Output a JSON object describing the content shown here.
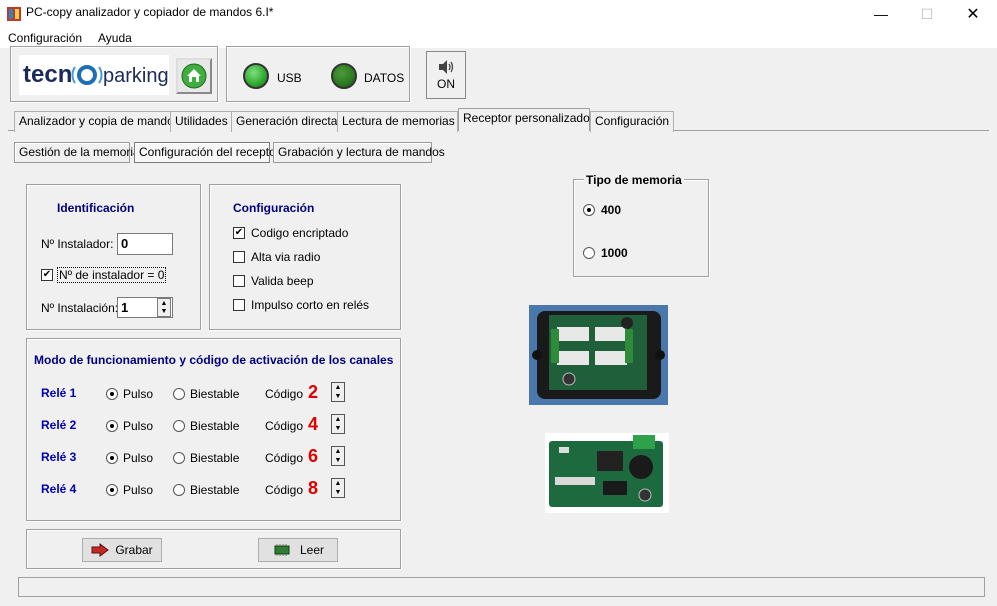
{
  "window": {
    "title": "PC-copy analizador y copiador de mandos 6.I*",
    "minimize": "—",
    "maximize": "☐",
    "close": "✕"
  },
  "menu": {
    "items": [
      {
        "label": "Configuración"
      },
      {
        "label": "Ayuda"
      }
    ]
  },
  "header": {
    "logo_left": "tecn",
    "logo_right": "parking",
    "led_usb": {
      "label": "USB",
      "color": "#2ea82e"
    },
    "led_datos": {
      "label": "DATOS",
      "color": "#2a7a1e"
    },
    "sound_label": "ON"
  },
  "tabs": [
    {
      "label": "Analizador y copia de mandos"
    },
    {
      "label": "Utilidades"
    },
    {
      "label": "Generación directa"
    },
    {
      "label": "Lectura de memorias"
    },
    {
      "label": "Receptor personalizado",
      "active": true
    },
    {
      "label": "Configuración"
    }
  ],
  "subtabs": [
    {
      "label": "Gestión de la memoria"
    },
    {
      "label": "Configuración del receptor",
      "active": true
    },
    {
      "label": "Grabación y lectura de mandos"
    }
  ],
  "identificacion": {
    "title": "Identificación",
    "instalador_label": "Nº Instalador:",
    "instalador_value": "0",
    "instalador_zero_label": "Nº de instalador = 0",
    "instalador_zero_checked": true,
    "instalacion_label": "Nº Instalación:",
    "instalacion_value": "1"
  },
  "configuracion": {
    "title": "Configuración",
    "options": [
      {
        "label": "Codigo encriptado",
        "checked": true
      },
      {
        "label": "Alta via radio",
        "checked": false
      },
      {
        "label": "Valida beep",
        "checked": false
      },
      {
        "label": "Impulso corto en relés",
        "checked": false
      }
    ]
  },
  "modo": {
    "title": "Modo de funcionamiento y código de activación de los canales",
    "pulso_label": "Pulso",
    "biestable_label": "Biestable",
    "codigo_label": "Código",
    "reles": [
      {
        "label": "Relé 1",
        "mode": "Pulso",
        "code": "2"
      },
      {
        "label": "Relé 2",
        "mode": "Pulso",
        "code": "4"
      },
      {
        "label": "Relé 3",
        "mode": "Pulso",
        "code": "6"
      },
      {
        "label": "Relé 4",
        "mode": "Pulso",
        "code": "8"
      }
    ]
  },
  "actions": {
    "grabar": "Grabar",
    "leer": "Leer"
  },
  "tipo_memoria": {
    "title": "Tipo de memoria",
    "options": [
      {
        "label": "400",
        "selected": true
      },
      {
        "label": "1000",
        "selected": false
      }
    ]
  }
}
